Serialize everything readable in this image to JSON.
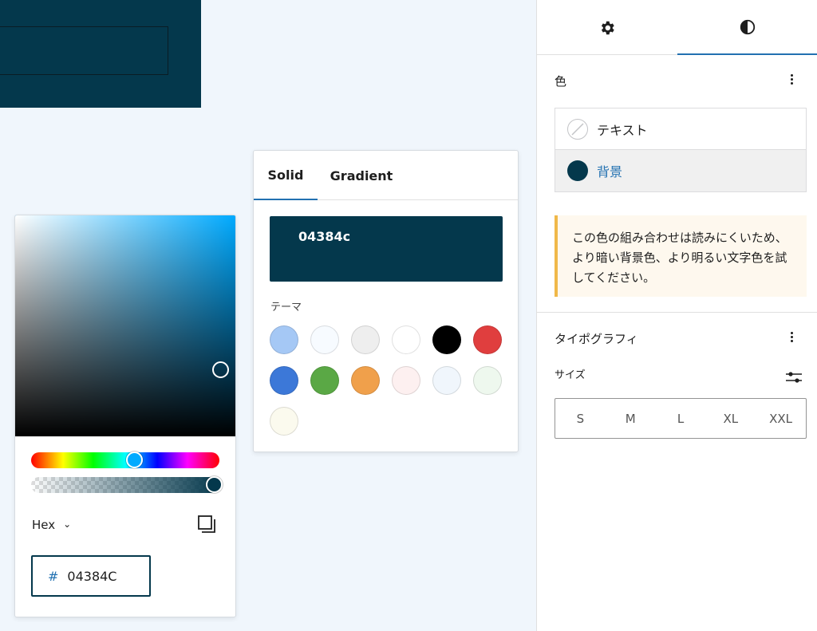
{
  "picker": {
    "format_label": "Hex",
    "hex_prefix": "#",
    "hex_value": "04384C"
  },
  "panel": {
    "tabs": [
      "Solid",
      "Gradient"
    ],
    "swatch_value": "04384c",
    "theme_label": "テーマ",
    "theme_colors": [
      "#a5c8f5",
      "#f7fbff",
      "#eeeeee",
      "#ffffff",
      "#000000",
      "#e03e3e",
      "#3c78d8",
      "#5aa845",
      "#f0a04b",
      "#fdf0f0",
      "#f0f6fc",
      "#eef8ee",
      "#fbfaee"
    ]
  },
  "sidebar": {
    "color_section": {
      "title": "色",
      "items": [
        {
          "label": "テキスト"
        },
        {
          "label": "背景",
          "color": "#04384c"
        }
      ],
      "notice": "この色の組み合わせは読みにくいため、より暗い背景色、より明るい文字色を試してください。"
    },
    "typography_section": {
      "title": "タイポグラフィ",
      "size_label": "サイズ",
      "sizes": [
        "S",
        "M",
        "L",
        "XL",
        "XXL"
      ]
    }
  },
  "colors": {
    "accent": "#2271b1",
    "block_bg": "#04384c"
  }
}
